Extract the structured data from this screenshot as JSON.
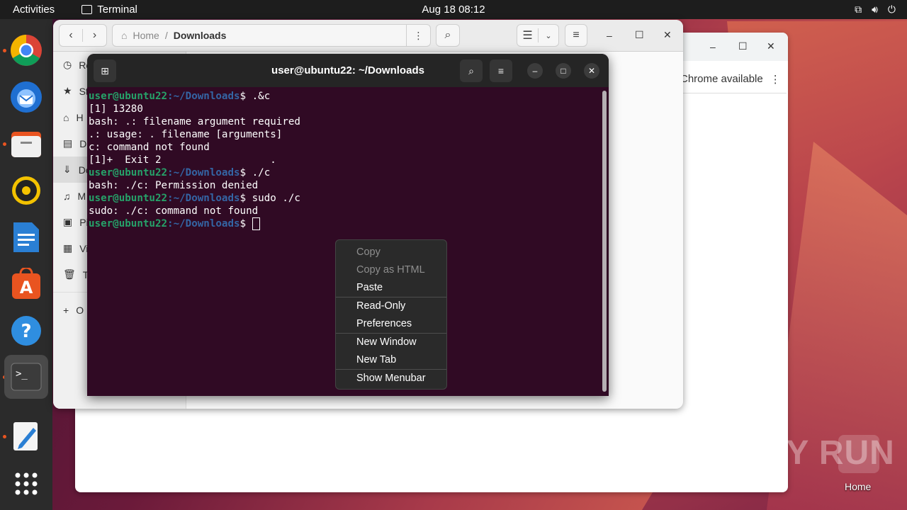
{
  "topbar": {
    "activities": "Activities",
    "app_name": "Terminal",
    "clock": "Aug 18  08:12",
    "tray_icons": [
      "network-icon",
      "volume-icon",
      "power-icon"
    ]
  },
  "dock": {
    "items": [
      "chrome",
      "thunderbird",
      "files",
      "rhythmbox",
      "libreoffice-writer",
      "app-center",
      "help",
      "terminal",
      "text-editor",
      "show-apps"
    ]
  },
  "files_window": {
    "path_home": "Home",
    "path_separator": "/",
    "path_current": "Downloads",
    "sidebar": [
      "Re",
      "St",
      "H",
      "Dc",
      "Dc",
      "M",
      "Pi",
      "Vi",
      "Tr",
      "O"
    ]
  },
  "chrome_window": {
    "info_text": "Chrome available"
  },
  "terminal": {
    "title": "user@ubuntu22: ~/Downloads",
    "prompt_user": "user@ubuntu22",
    "prompt_path": ":~/Downloads",
    "lines": [
      {
        "type": "cmd",
        "cmd": "$ .&c"
      },
      {
        "type": "out",
        "text": "[1] 13280"
      },
      {
        "type": "out",
        "text": "bash: .: filename argument required"
      },
      {
        "type": "out",
        "text": ".: usage: . filename [arguments]"
      },
      {
        "type": "out",
        "text": "c: command not found"
      },
      {
        "type": "out",
        "text": "[1]+  Exit 2                  ."
      },
      {
        "type": "cmd",
        "cmd": "$ ./c"
      },
      {
        "type": "out",
        "text": "bash: ./c: Permission denied"
      },
      {
        "type": "cmd",
        "cmd": "$ sudo ./c"
      },
      {
        "type": "out",
        "text": "sudo: ./c: command not found"
      },
      {
        "type": "cmd",
        "cmd": "$ "
      }
    ]
  },
  "context_menu": {
    "copy": "Copy",
    "copy_html": "Copy as HTML",
    "paste": "Paste",
    "read_only": "Read-Only",
    "preferences": "Preferences",
    "new_window": "New Window",
    "new_tab": "New Tab",
    "show_menubar": "Show Menubar"
  },
  "desktop": {
    "home_label": "Home",
    "watermark": "ANY RUN"
  }
}
